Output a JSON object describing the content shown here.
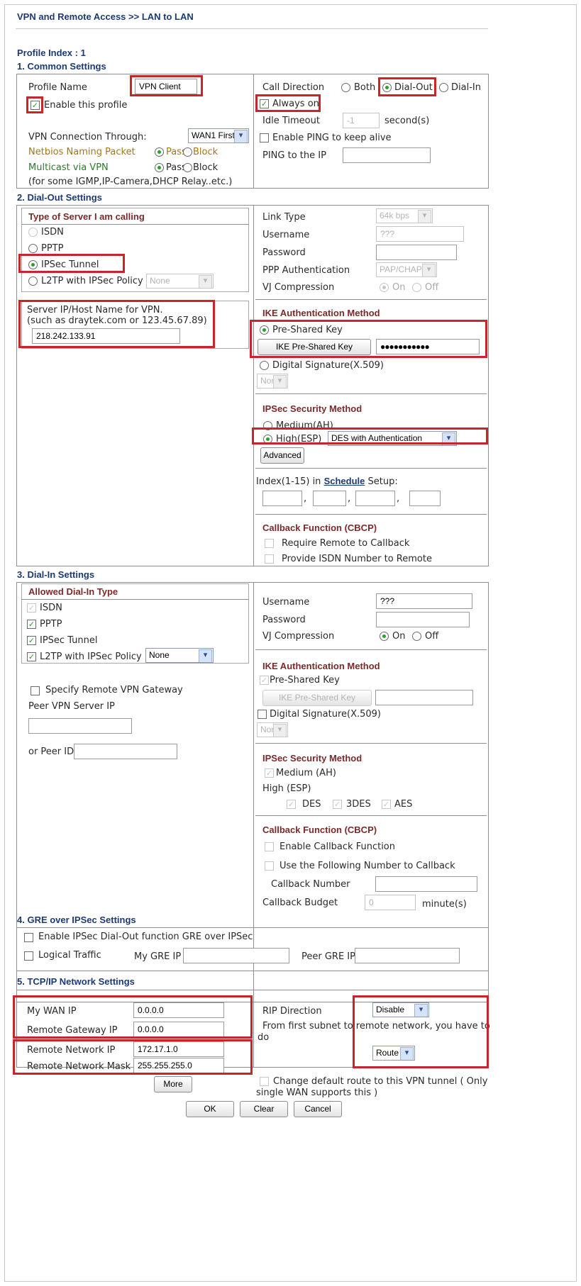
{
  "breadcrumb": "VPN and Remote Access >> LAN to LAN",
  "profile_index": "Profile Index : 1",
  "common": {
    "title": "1. Common Settings",
    "profile_name_label": "Profile Name",
    "profile_name_value": "VPN Client",
    "enable_label": "Enable this profile",
    "vpn_through_label": "VPN Connection Through:",
    "vpn_through_value": "WAN1 First",
    "netbios_label": "Netbios Naming Packet",
    "multicast_label": "Multicast via VPN",
    "pass_label": "Pass",
    "block_label": "Block",
    "note": "(for some IGMP,IP-Camera,DHCP Relay..etc.)",
    "call_direction_label": "Call Direction",
    "both_label": "Both",
    "dial_out_label": "Dial-Out",
    "dial_in_label": "Dial-In",
    "always_on_label": "Always on",
    "idle_timeout_label": "Idle Timeout",
    "idle_timeout_value": "-1",
    "seconds_label": "second(s)",
    "enable_ping_label": "Enable PING to keep alive",
    "ping_ip_label": "PING to the IP"
  },
  "dialout": {
    "title": "2. Dial-Out Settings",
    "server_type_title": "Type of Server I am calling",
    "isdn_label": "ISDN",
    "pptp_label": "PPTP",
    "ipsec_label": "IPSec Tunnel",
    "l2tp_label": "L2TP with IPSec Policy",
    "l2tp_policy_value": "None",
    "server_ip_label_1": "Server IP/Host Name for VPN.",
    "server_ip_label_2": "(such as draytek.com or 123.45.67.89)",
    "server_ip_value": "218.242.133.91",
    "link_type_label": "Link Type",
    "link_type_value": "64k bps",
    "username_label": "Username",
    "username_value": "???",
    "password_label": "Password",
    "ppp_auth_label": "PPP Authentication",
    "ppp_auth_value": "PAP/CHAP",
    "vj_label": "VJ Compression",
    "on_label": "On",
    "off_label": "Off",
    "ike_title": "IKE Authentication Method",
    "psk_label": "Pre-Shared Key",
    "ike_psk_button": "IKE Pre-Shared Key",
    "psk_value": "●●●●●●●●●●●",
    "digital_sig_label": "Digital Signature(X.509)",
    "digital_sig_value": "None",
    "ipsec_title": "IPSec Security Method",
    "medium_label": "Medium(AH)",
    "high_label": "High(ESP)",
    "high_value": "DES with Authentication",
    "advanced_button": "Advanced",
    "schedule_prefix": "Index(1-15) in ",
    "schedule_link": "Schedule",
    "schedule_suffix": " Setup:",
    "callback_title": "Callback Function (CBCP)",
    "require_callback_label": "Require Remote to Callback",
    "provide_isdn_label": "Provide ISDN Number to Remote"
  },
  "dialin": {
    "title": "3. Dial-In Settings",
    "allowed_title": "Allowed Dial-In Type",
    "isdn_label": "ISDN",
    "pptp_label": "PPTP",
    "ipsec_label": "IPSec Tunnel",
    "l2tp_label": "L2TP with IPSec Policy",
    "l2tp_policy_value": "None",
    "specify_gateway_label": "Specify Remote VPN Gateway",
    "peer_server_label": "Peer VPN Server IP",
    "peer_id_label": "or Peer ID",
    "username_label": "Username",
    "username_value": "???",
    "password_label": "Password",
    "vj_label": "VJ Compression",
    "on_label": "On",
    "off_label": "Off",
    "ike_title": "IKE Authentication Method",
    "psk_label": "Pre-Shared Key",
    "ike_psk_button": "IKE Pre-Shared Key",
    "digital_sig_label": "Digital Signature(X.509)",
    "digital_sig_value": "None",
    "ipsec_title": "IPSec Security Method",
    "medium_label": "Medium (AH)",
    "high_label": "High (ESP)",
    "des_label": "DES",
    "tdes_label": "3DES",
    "aes_label": "AES",
    "callback_title": "Callback Function (CBCP)",
    "enable_callback_label": "Enable Callback Function",
    "use_following_label": "Use the Following Number to Callback",
    "callback_number_label": "Callback Number",
    "callback_budget_label": "Callback Budget",
    "callback_budget_value": "0",
    "minutes_label": "minute(s)"
  },
  "gre": {
    "title": "4. GRE over IPSec Settings",
    "enable_label": "Enable IPSec Dial-Out function GRE over IPSec",
    "logical_label": "Logical Traffic",
    "my_gre_label": "My GRE IP",
    "peer_gre_label": "Peer GRE IP"
  },
  "tcpip": {
    "title": "5. TCP/IP Network Settings",
    "my_wan_label": "My WAN IP",
    "my_wan_value": "0.0.0.0",
    "remote_gw_label": "Remote Gateway IP",
    "remote_gw_value": "0.0.0.0",
    "remote_net_label": "Remote Network IP",
    "remote_net_value": "172.17.1.0",
    "remote_mask_label": "Remote Network Mask",
    "remote_mask_value": "255.255.255.0",
    "more_button": "More",
    "rip_label": "RIP Direction",
    "rip_value": "Disable",
    "from_subnet_1": "From first subnet to remote network, you have to",
    "from_subnet_2": "do",
    "route_value": "Route",
    "change_default_1": "Change default route to this VPN tunnel ( Only",
    "change_default_2": "single WAN supports this )"
  },
  "buttons": {
    "ok": "OK",
    "clear": "Clear",
    "cancel": "Cancel"
  },
  "colors": {
    "highlight": "#c8252b",
    "heading": "#1c3a73",
    "check": "#26a32a"
  }
}
